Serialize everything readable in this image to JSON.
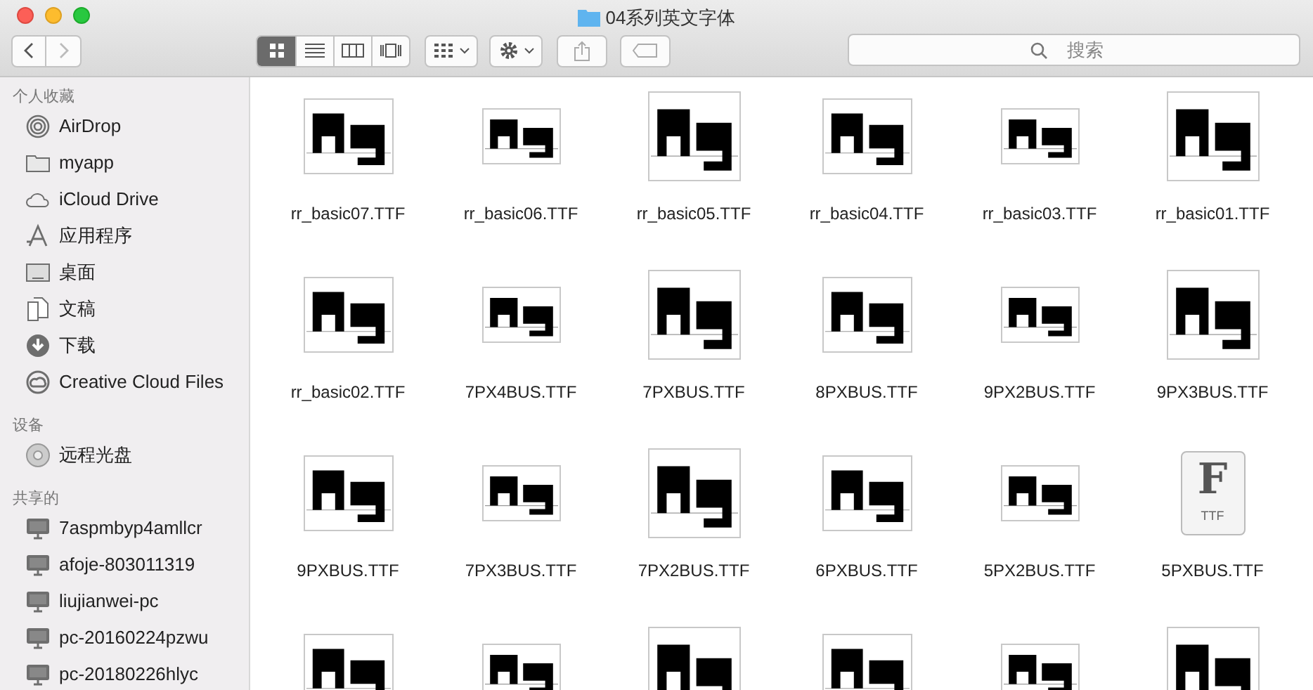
{
  "window": {
    "title": "04系列英文字体"
  },
  "toolbar": {
    "view_modes": [
      {
        "kind": "icons",
        "selected": true
      },
      {
        "kind": "list",
        "selected": false
      },
      {
        "kind": "columns",
        "selected": false
      },
      {
        "kind": "coverflow",
        "selected": false
      }
    ],
    "search": {
      "placeholder": "搜索"
    }
  },
  "sidebar": {
    "sections": [
      {
        "title": "个人收藏",
        "items": [
          {
            "label": "AirDrop",
            "kind": "airdrop"
          },
          {
            "label": "myapp",
            "kind": "folder"
          },
          {
            "label": "iCloud Drive",
            "kind": "cloud"
          },
          {
            "label": "应用程序",
            "kind": "apps"
          },
          {
            "label": "桌面",
            "kind": "desktop"
          },
          {
            "label": "文稿",
            "kind": "documents"
          },
          {
            "label": "下载",
            "kind": "downloads"
          },
          {
            "label": "Creative Cloud Files",
            "kind": "creative"
          }
        ]
      },
      {
        "title": "设备",
        "items": [
          {
            "label": "远程光盘",
            "kind": "disc"
          }
        ]
      },
      {
        "title": "共享的",
        "items": [
          {
            "label": "7aspmbyp4amllcr",
            "kind": "computer"
          },
          {
            "label": "afoje-803011319",
            "kind": "computer"
          },
          {
            "label": "liujianwei-pc",
            "kind": "computer"
          },
          {
            "label": "pc-20160224pzwu",
            "kind": "computer"
          },
          {
            "label": "pc-20180226hlyc",
            "kind": "computer"
          }
        ]
      }
    ]
  },
  "files": [
    {
      "name": "rr_basic07.TTF",
      "kind": "preview"
    },
    {
      "name": "rr_basic06.TTF",
      "kind": "preview"
    },
    {
      "name": "rr_basic05.TTF",
      "kind": "preview"
    },
    {
      "name": "rr_basic04.TTF",
      "kind": "preview"
    },
    {
      "name": "rr_basic03.TTF",
      "kind": "preview"
    },
    {
      "name": "rr_basic01.TTF",
      "kind": "preview"
    },
    {
      "name": "rr_basic02.TTF",
      "kind": "preview"
    },
    {
      "name": "7PX4BUS.TTF",
      "kind": "preview"
    },
    {
      "name": "7PXBUS.TTF",
      "kind": "preview"
    },
    {
      "name": "8PXBUS.TTF",
      "kind": "preview"
    },
    {
      "name": "9PX2BUS.TTF",
      "kind": "preview"
    },
    {
      "name": "9PX3BUS.TTF",
      "kind": "preview"
    },
    {
      "name": "9PXBUS.TTF",
      "kind": "preview"
    },
    {
      "name": "7PX3BUS.TTF",
      "kind": "preview"
    },
    {
      "name": "7PX2BUS.TTF",
      "kind": "preview"
    },
    {
      "name": "6PXBUS.TTF",
      "kind": "preview"
    },
    {
      "name": "5PX2BUS.TTF",
      "kind": "preview"
    },
    {
      "name": "5PXBUS.TTF",
      "kind": "generic",
      "glyph": "F",
      "badge": "TTF"
    },
    {
      "kind": "preview"
    },
    {
      "kind": "preview"
    },
    {
      "kind": "preview"
    },
    {
      "kind": "preview"
    },
    {
      "kind": "preview"
    },
    {
      "kind": "preview"
    }
  ]
}
